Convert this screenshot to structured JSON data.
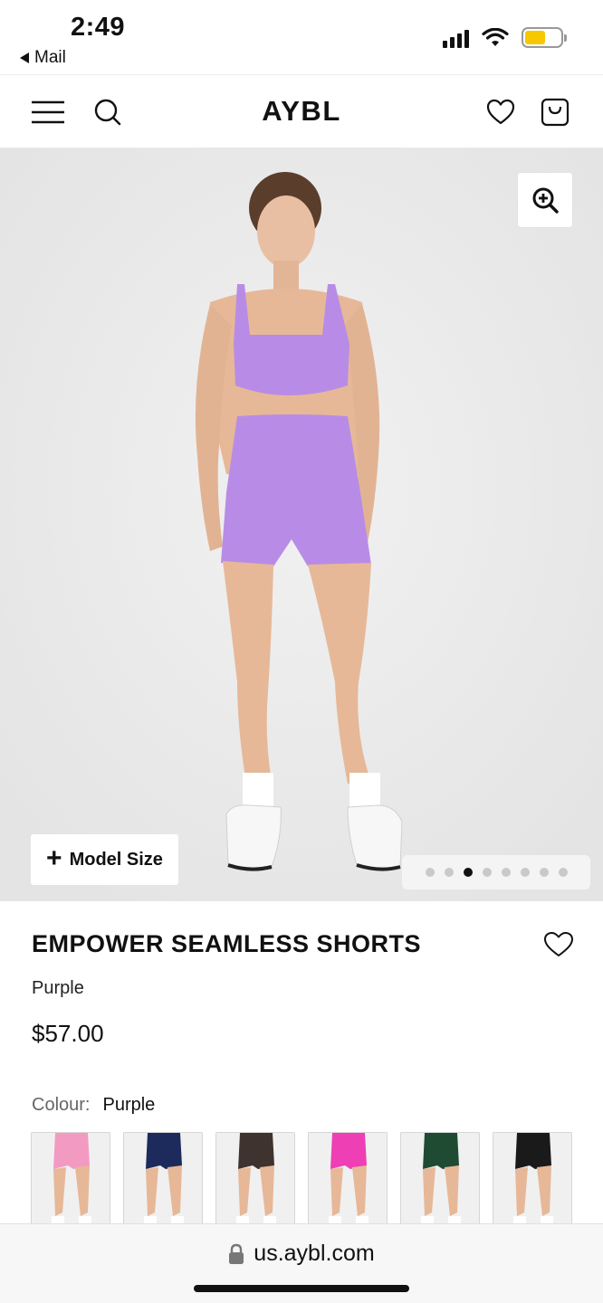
{
  "status": {
    "time": "2:49",
    "back_label": "Mail",
    "battery_color": "#f7c800"
  },
  "header": {
    "brand": "AYBL",
    "icons": [
      "menu-icon",
      "search-icon",
      "heart-icon",
      "bag-icon"
    ]
  },
  "hero": {
    "model_size_label": "Model Size",
    "image_count": 8,
    "active_image_index": 3,
    "outfit_color": "#b88ce6"
  },
  "product": {
    "title": "EMPOWER SEAMLESS SHORTS",
    "colour_name": "Purple",
    "price": "$57.00",
    "colour_label": "Colour:",
    "colour_value": "Purple",
    "swatches": [
      {
        "name": "pink",
        "color": "#f29ac2"
      },
      {
        "name": "navy",
        "color": "#1d2a5c"
      },
      {
        "name": "brown",
        "color": "#3e332e"
      },
      {
        "name": "magenta",
        "color": "#ee3fb5"
      },
      {
        "name": "green",
        "color": "#1f4b33"
      },
      {
        "name": "black",
        "color": "#1a1a1a"
      }
    ]
  },
  "browser": {
    "url": "us.aybl.com"
  }
}
